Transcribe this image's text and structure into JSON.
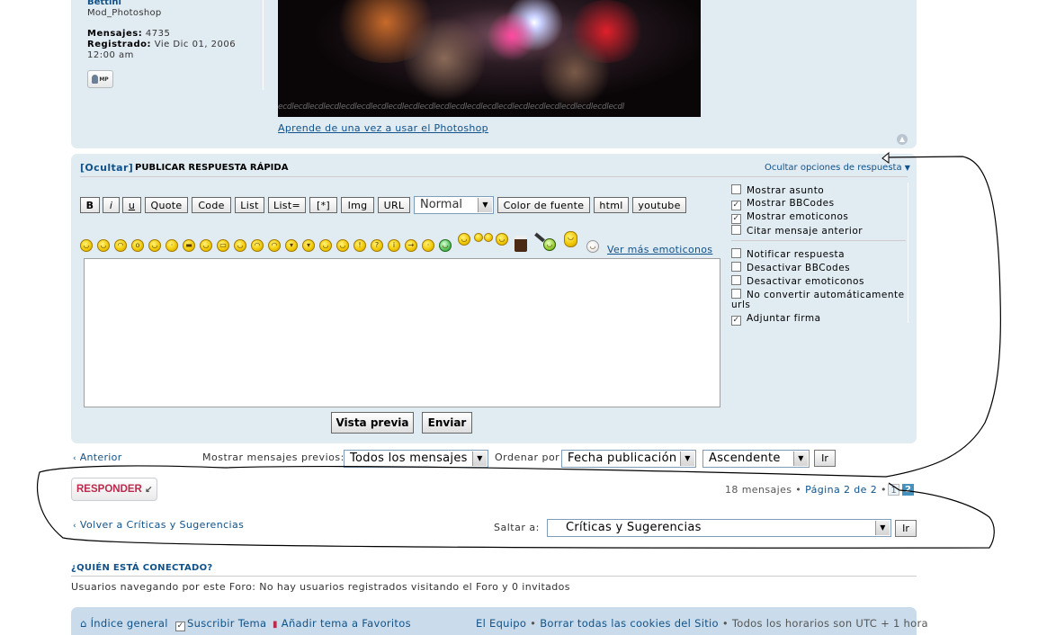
{
  "post": {
    "author": "Bettini",
    "rank": "Mod_Photoshop",
    "posts_label": "Mensajes:",
    "posts_value": "4735",
    "registered_label": "Registrado:",
    "registered_value": "Vie Dic 01, 2006",
    "registered_time": "12:00 am",
    "pm_label": "MP",
    "banner_watermark": "ecdlecdlecdlecdlecdlecdlecdlecdlecdlecdlecdlecdlecdlecdlecdlecdlecdlecdlecdlecdlecdlecdl",
    "signature_link": "Aprende de una vez a usar el Photoshop"
  },
  "quick_reply": {
    "toggle": "[Ocultar]",
    "title": "PUBLICAR RESPUESTA RÁPIDA",
    "options_link": "Ocultar opciones de respuesta",
    "toolbar": {
      "bold": "B",
      "italic": "i",
      "underline": "u",
      "quote": "Quote",
      "code": "Code",
      "list": "List",
      "list_eq": "List=",
      "list_item": "[*]",
      "img": "Img",
      "url": "URL",
      "size": "Normal",
      "font_color": "Color de fuente",
      "html": "html",
      "youtube": "youtube"
    },
    "more_smilies": "Ver más emoticonos",
    "preview": "Vista previa",
    "submit": "Enviar",
    "options": [
      {
        "label": "Mostrar asunto",
        "checked": false
      },
      {
        "label": "Mostrar BBCodes",
        "checked": true
      },
      {
        "label": "Mostrar emoticonos",
        "checked": true
      },
      {
        "label": "Citar mensaje anterior",
        "checked": false
      },
      {
        "label": "Notificar respuesta",
        "checked": false
      },
      {
        "label": "Desactivar BBCodes",
        "checked": false
      },
      {
        "label": "Desactivar emoticonos",
        "checked": false
      },
      {
        "label": "No convertir automáticamente",
        "label2": "urls",
        "checked": false
      },
      {
        "label": "Adjuntar firma",
        "checked": true
      }
    ]
  },
  "sort_bar": {
    "previous": "Anterior",
    "show_label": "Mostrar mensajes previos:",
    "show_value": "Todos los mensajes",
    "order_label": "Ordenar por",
    "order_value": "Fecha publicación",
    "direction_value": "Ascendente",
    "go": "Ir"
  },
  "pagination": {
    "reply_button": "RESPONDER",
    "count": "18 mensajes",
    "page_text": "Página 2 de 2",
    "pages": [
      "1",
      "2"
    ],
    "current": "2"
  },
  "jump": {
    "back_link": "Volver a Críticas y Sugerencias",
    "label": "Saltar a:",
    "value": "Críticas y Sugerencias",
    "go": "Ir"
  },
  "online": {
    "title": "¿QUIÉN ESTÁ CONECTADO?",
    "text": "Usuarios navegando por este Foro: No hay usuarios registrados visitando el Foro y 0 invitados"
  },
  "footer": {
    "index": "Índice general",
    "subscribe": "Suscribir Tema",
    "bookmark": "Añadir tema a Favoritos",
    "team": "El Equipo",
    "delete_cookies": "Borrar todas las cookies del Sitio",
    "timezone": "Todos los horarios son UTC + 1 hora"
  },
  "colors": {
    "panel": "#e1ebf2",
    "footer": "#cadceb",
    "link": "#105289",
    "reply_red": "#bc2a4d"
  }
}
